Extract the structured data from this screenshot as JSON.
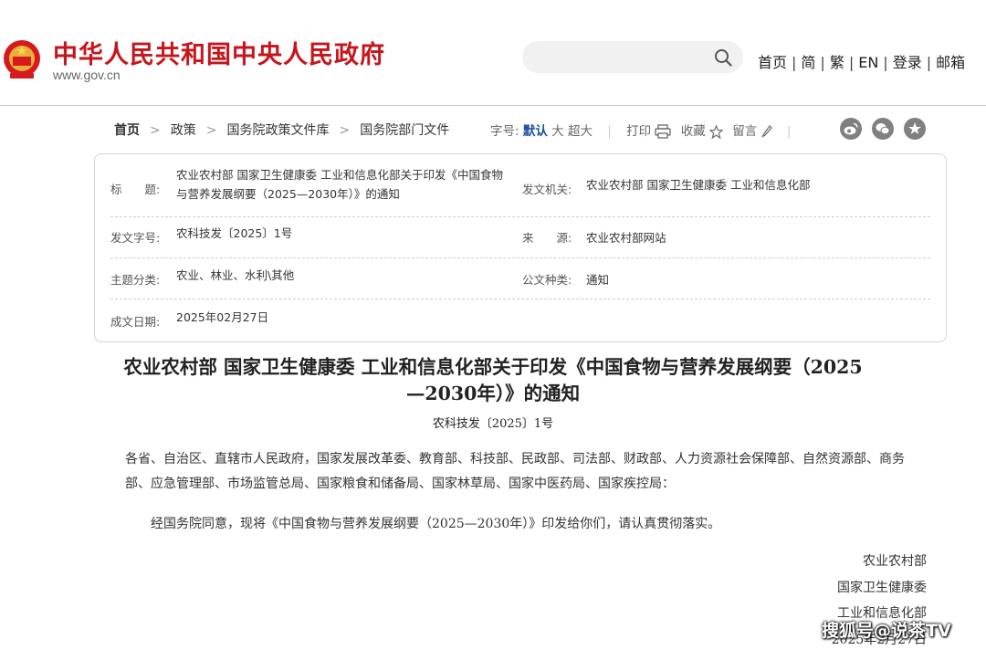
{
  "header": {
    "site_title": "中华人民共和国中央人民政府",
    "site_url": "www.gov.cn",
    "search": {
      "placeholder": ""
    },
    "top_links": [
      "首页",
      "简",
      "繁",
      "EN",
      "登录",
      "邮箱"
    ]
  },
  "breadcrumb": [
    "首页",
    "政策",
    "国务院政策文件库",
    "国务院部门文件"
  ],
  "toolbar": {
    "font_size_label": "字号:",
    "font_sizes": [
      "默认",
      "大",
      "超大"
    ],
    "print_label": "打印",
    "favorite_label": "收藏",
    "comment_label": "留言"
  },
  "meta": {
    "title_label": "标　　题:",
    "title_value": "农业农村部 国家卫生健康委 工业和信息化部关于印发《中国食物与营养发展纲要（2025—2030年）》的通知",
    "issuer_label": "发文机关:",
    "issuer_value": "农业农村部 国家卫生健康委 工业和信息化部",
    "doc_no_label": "发文字号:",
    "doc_no_value": "农科技发〔2025〕1号",
    "source_label": "来　　源:",
    "source_value": "农业农村部网站",
    "topic_label": "主题分类:",
    "topic_value": "农业、林业、水利\\其他",
    "type_label": "公文种类:",
    "type_value": "通知",
    "date_label": "成文日期:",
    "date_value": "2025年02月27日"
  },
  "document": {
    "title": "农业农村部 国家卫生健康委 工业和信息化部关于印发《中国食物与营养发展纲要（2025—2030年）》的通知",
    "number": "农科技发〔2025〕1号",
    "addressees": "各省、自治区、直辖市人民政府，国家发展改革委、教育部、科技部、民政部、司法部、财政部、人力资源社会保障部、自然资源部、商务部、应急管理部、市场监管总局、国家粮食和储备局、国家林草局、国家中医药局、国家疾控局：",
    "body": "经国务院同意，现将《中国食物与营养发展纲要（2025—2030年）》印发给你们，请认真贯彻落实。",
    "signatures": [
      "农业农村部",
      "国家卫生健康委",
      "工业和信息化部"
    ],
    "sign_date": "2025年2月27日"
  },
  "watermark": "搜狐号@说茶TV",
  "colors": {
    "brand_red": "#c7151b",
    "selected_blue": "#1c4e9c",
    "share_gray": "#808080"
  },
  "icons": [
    "national-emblem",
    "search-icon",
    "print-icon",
    "star-icon",
    "pencil-icon",
    "weibo-icon",
    "wechat-icon",
    "favorite-star-icon"
  ]
}
